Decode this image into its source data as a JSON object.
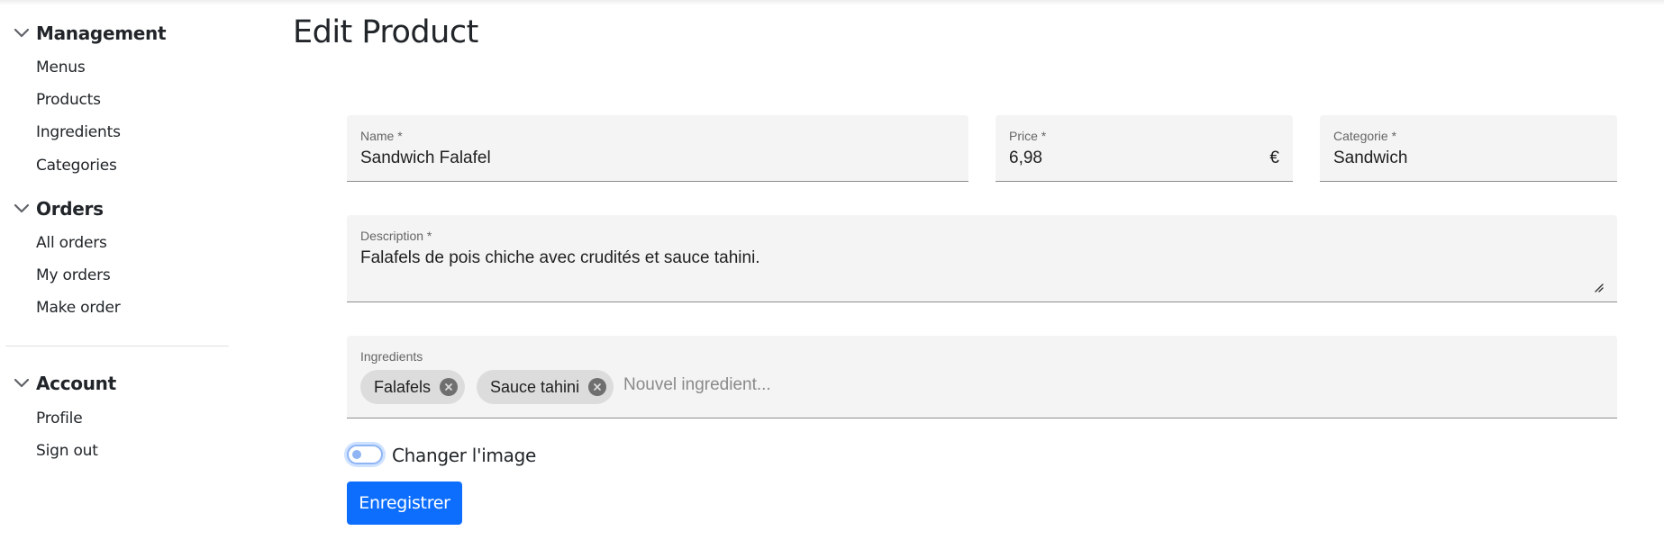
{
  "sidebar": {
    "sections": [
      {
        "title": "Management",
        "items": [
          "Menus",
          "Products",
          "Ingredients",
          "Categories"
        ]
      },
      {
        "title": "Orders",
        "items": [
          "All orders",
          "My orders",
          "Make order"
        ]
      },
      {
        "title": "Account",
        "items": [
          "Profile",
          "Sign out"
        ]
      }
    ],
    "icons": {
      "section_toggle": "chevron-down-icon"
    }
  },
  "main": {
    "title": "Edit Product",
    "form": {
      "name": {
        "label": "Name *",
        "value": "Sandwich Falafel"
      },
      "price": {
        "label": "Price *",
        "value": "6,98",
        "suffix": "€"
      },
      "category": {
        "label": "Categorie *",
        "value": "Sandwich"
      },
      "description": {
        "label": "Description *",
        "value": "Falafels de pois chiche avec crudités et sauce tahini."
      },
      "ingredients": {
        "label": "Ingredients",
        "chips": [
          "Falafels",
          "Sauce tahini"
        ],
        "placeholder": "Nouvel ingredient..."
      },
      "change_image": {
        "label": "Changer l'image",
        "checked": false
      },
      "submit_label": "Enregistrer"
    }
  },
  "colors": {
    "primary": "#0d6efd",
    "field_background": "#f4f4f4",
    "chip_background": "#dcdcdc",
    "toggle_border": "#8fb5f5"
  }
}
